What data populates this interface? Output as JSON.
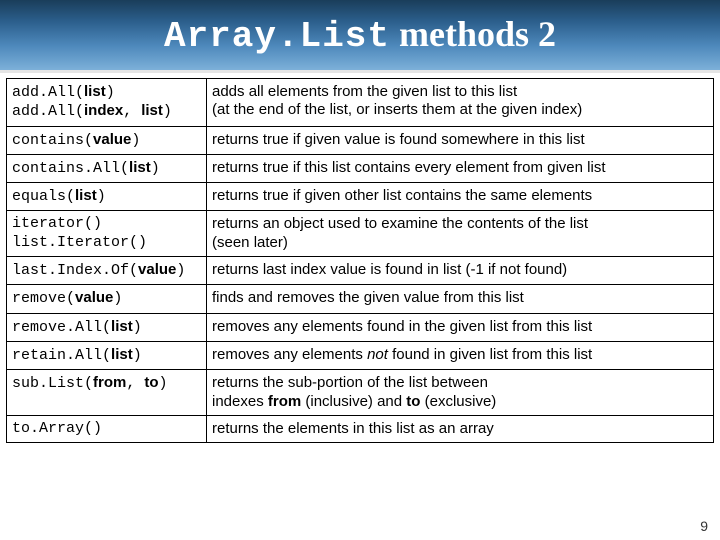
{
  "title": {
    "mono": "Array.List",
    "rest": " methods 2"
  },
  "rows": [
    {
      "sig": "add.All(<b>list</b>)<br>add.All(<b>index</b>, <b>list</b>)",
      "desc": "adds all elements from the given list to this list<br>(at the end of the list, or inserts them at the given index)"
    },
    {
      "sig": "contains(<b>value</b>)",
      "desc": "returns true if given value is found somewhere in this list"
    },
    {
      "sig": "contains.All(<b>list</b>)",
      "desc": "returns true if this list contains every element from given list"
    },
    {
      "sig": "equals(<b>list</b>)",
      "desc": "returns true if given other list contains the same elements"
    },
    {
      "sig": "iterator()<br>list.Iterator()",
      "desc": "returns an object used to examine the contents of the list<br>(seen later)"
    },
    {
      "sig": "last.Index.Of(<b>value</b>)",
      "desc": "returns last index value is found in list (-1 if not found)"
    },
    {
      "sig": "remove(<b>value</b>)",
      "desc": "finds and removes the given value from this list"
    },
    {
      "sig": "remove.All(<b>list</b>)",
      "desc": "removes any elements found in the given list from this list"
    },
    {
      "sig": "retain.All(<b>list</b>)",
      "desc": "removes any elements <em>not</em> found in given list from this list"
    },
    {
      "sig": "sub.List(<b>from</b>, <b>to</b>)",
      "desc": "returns the sub-portion of the list between<br>indexes <b>from</b> (inclusive) and <b>to</b> (exclusive)"
    },
    {
      "sig": "to.Array()",
      "desc": "returns the elements in this list as an array"
    }
  ],
  "page_number": "9"
}
